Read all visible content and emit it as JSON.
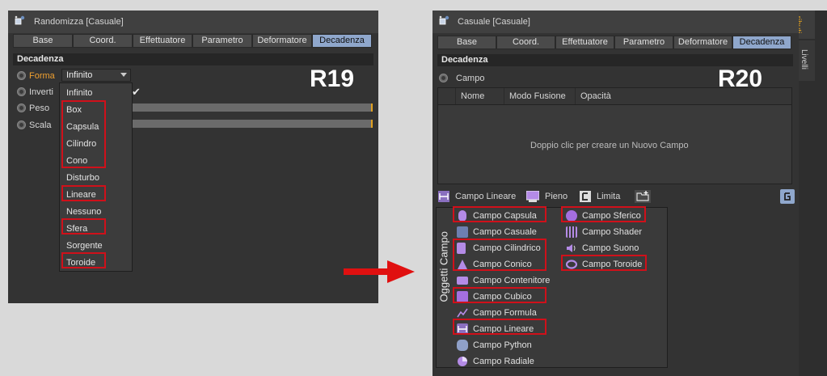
{
  "left": {
    "title": "Randomizza [Casuale]",
    "tabs": [
      "Base",
      "Coord.",
      "Effettuatore",
      "Parametro",
      "Deformatore",
      "Decadenza"
    ],
    "section": "Decadenza",
    "params": {
      "forma": "Forma",
      "invert": "Inverti",
      "peso": "Peso",
      "scala": "Scala"
    },
    "dropdown_value": "Infinito",
    "options": [
      "Infinito",
      "Box",
      "Capsula",
      "Cilindro",
      "Cono",
      "Disturbo",
      "Lineare",
      "Nessuno",
      "Sfera",
      "Sorgente",
      "Toroide"
    ],
    "version_label": "R19",
    "check_mark": "✔"
  },
  "right": {
    "title": "Casuale [Casuale]",
    "tabs": [
      "Base",
      "Coord.",
      "Effettuatore",
      "Parametro",
      "Deformatore",
      "Decadenza"
    ],
    "section": "Decadenza",
    "campo_label": "Campo",
    "columns": [
      "Nome",
      "Modo Fusione",
      "Opacità"
    ],
    "empty_hint": "Doppio clic per creare un  Nuovo Campo",
    "version_label": "R20",
    "side_tabs": [
      "ributi",
      "Livelli"
    ],
    "toolbar": {
      "linear": "Campo Lineare",
      "solid": "Pieno",
      "clamp": "Limita"
    },
    "menu_title": "Oggetti Campo",
    "menu_col1": [
      "Campo Capsula",
      "Campo Casuale",
      "Campo Cilindrico",
      "Campo Conico",
      "Campo Contenitore",
      "Campo Cubico",
      "Campo Formula",
      "Campo Lineare",
      "Campo Python",
      "Campo Radiale"
    ],
    "menu_col2": [
      "Campo Sferico",
      "Campo Shader",
      "Campo Suono",
      "Campo Toroide"
    ]
  },
  "colors": {
    "highlight": "#d0101a",
    "active_tab": "#8fa7cc",
    "accent_orange": "#e0a020"
  }
}
